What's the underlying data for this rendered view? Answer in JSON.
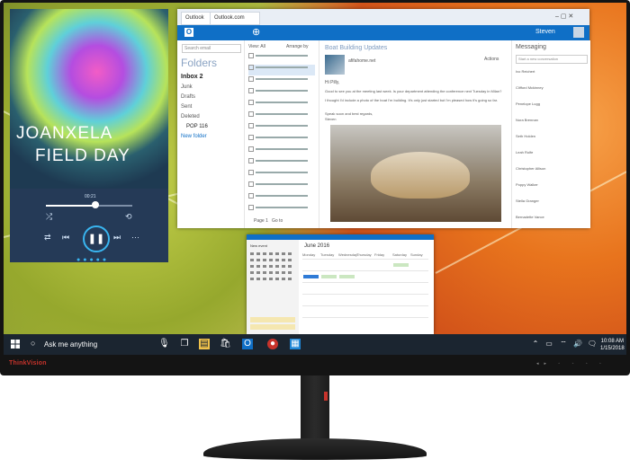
{
  "music": {
    "artist": "JOANXELA",
    "album": "FIELD DAY",
    "elapsed": "00:21",
    "progress": 0.55,
    "controls": [
      "shuffle-icon",
      "prev-icon",
      "play-pause-icon",
      "next-icon",
      "repeat-icon"
    ]
  },
  "mail": {
    "browser_tabs": [
      "Outlook",
      "Outlook.com"
    ],
    "app_name": "Outlook",
    "search_placeholder": "Search email",
    "folders_header": "Folders",
    "folders": [
      {
        "name": "Inbox",
        "count": "2"
      },
      {
        "name": "Junk",
        "count": ""
      },
      {
        "name": "Drafts",
        "count": ""
      },
      {
        "name": "Sent",
        "count": ""
      },
      {
        "name": "Deleted",
        "count": ""
      },
      {
        "name": "POP",
        "count": "116"
      }
    ],
    "new_folder": "New folder",
    "list_header_view": "View: All",
    "list_header_arrange": "Arrange by",
    "subject": "Boat Building Updates",
    "sender": "afifahome.net",
    "greeting": "Hi Pilly,",
    "body": "Good to see you at the meeting last week. Is your department attending the conference next Tuesday in Milan?",
    "body2": "I thought I'd include a photo of the boat I'm building. It's only just started but I'm pleased how it's going so far.",
    "signoff": "Speak soon and best regards,",
    "signature": "Steven",
    "user": "Steven",
    "page_label": "Page 1",
    "go_to": "Go to",
    "actions_label": "Actions",
    "messaging_header": "Messaging",
    "messaging_placeholder": "Start a new conversation",
    "contacts": [
      "Ivo Reichert",
      "Clifford Mckinney",
      "Penelope Lugg",
      "Nora Brennan",
      "Seth Holden",
      "Leah Rolfe",
      "Christopher Allison",
      "Poppy Walker",
      "Stella Granger",
      "Bernadette Vance"
    ]
  },
  "calendar": {
    "month_label": "June 2016",
    "new_event": "New event",
    "day_headers": [
      "Monday",
      "Tuesday",
      "Wednesday",
      "Thursday",
      "Friday",
      "Saturday",
      "Sunday"
    ]
  },
  "taskbar": {
    "search_text": "Ask me anything",
    "time": "10:08 AM",
    "date": "1/15/2018"
  },
  "monitor": {
    "brand": "ThinkVision"
  }
}
